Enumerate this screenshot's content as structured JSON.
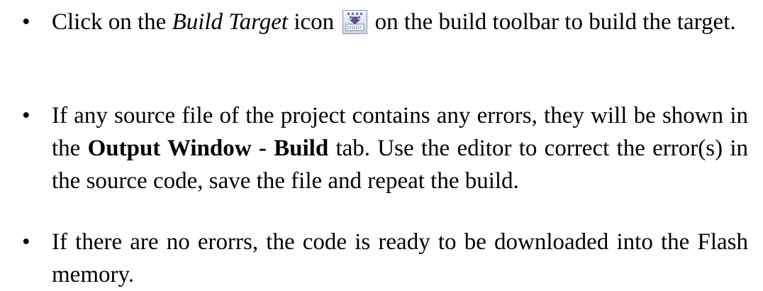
{
  "items": [
    {
      "bullet": "•",
      "before_em": "Click on the ",
      "em": "Build Target",
      "after_em": " icon ",
      "icon": "build-target-icon",
      "after_icon": " on the build toolbar to build the target."
    },
    {
      "bullet": "•",
      "before_strong": "If any source file of the project contains any errors, they will be shown in the ",
      "strong": "Output Window - Build",
      "after_strong": " tab. Use the editor to correct the error(s) in the source code, save the file and repeat the build."
    },
    {
      "bullet": "•",
      "text": "If there are no erorrs, the code is ready to be downloaded into the Flash memory."
    }
  ]
}
